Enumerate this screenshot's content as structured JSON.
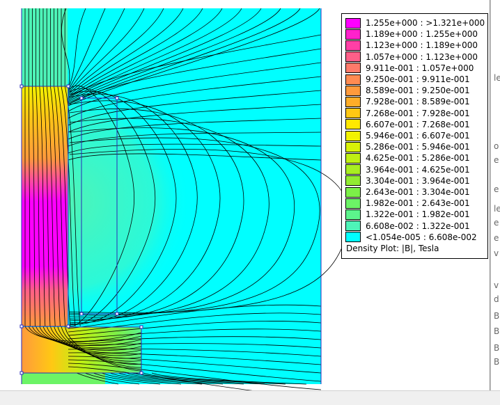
{
  "legend": {
    "title": "Density Plot: |B|, Tesla",
    "entries": [
      {
        "label": "1.255e+000 : >1.321e+000",
        "color": "#ff00ff"
      },
      {
        "label": "1.189e+000 : 1.255e+000",
        "color": "#ff22cc"
      },
      {
        "label": "1.123e+000 : 1.189e+000",
        "color": "#ff3fa6"
      },
      {
        "label": "1.057e+000 : 1.123e+000",
        "color": "#ff5f88"
      },
      {
        "label": "9.911e-001 : 1.057e+000",
        "color": "#ff7a6a"
      },
      {
        "label": "9.250e-001 : 9.911e-001",
        "color": "#ff8b52"
      },
      {
        "label": "8.589e-001 : 9.250e-001",
        "color": "#ff9a3c"
      },
      {
        "label": "7.928e-001 : 8.589e-001",
        "color": "#ffad28"
      },
      {
        "label": "7.268e-001 : 7.928e-001",
        "color": "#ffc814"
      },
      {
        "label": "6.607e-001 : 7.268e-001",
        "color": "#ffe800"
      },
      {
        "label": "5.946e-001 : 6.607e-001",
        "color": "#f2f200"
      },
      {
        "label": "5.286e-001 : 5.946e-001",
        "color": "#d9f208"
      },
      {
        "label": "4.625e-001 : 5.286e-001",
        "color": "#bff014"
      },
      {
        "label": "3.964e-001 : 4.625e-001",
        "color": "#a8ee22"
      },
      {
        "label": "3.304e-001 : 3.964e-001",
        "color": "#92ec32"
      },
      {
        "label": "2.643e-001 : 3.304e-001",
        "color": "#7cf048"
      },
      {
        "label": "1.982e-001 : 2.643e-001",
        "color": "#6cf466"
      },
      {
        "label": "1.322e-001 : 1.982e-001",
        "color": "#5cf48c"
      },
      {
        "label": "6.608e-002 : 1.322e-001",
        "color": "#4ef4b8"
      },
      {
        "label": "<1.054e-005 : 6.608e-002",
        "color": "#00ffff"
      }
    ]
  },
  "colors": {
    "background": "#00ffff",
    "contour": "#000000",
    "geometry": "#2a2ab8"
  },
  "right_panel_fragments": [
    "le",
    "o",
    "e",
    "e",
    "le",
    "e",
    "e",
    "v",
    "v",
    "d",
    "Bi",
    "Bi",
    "Bi",
    "Bi"
  ]
}
